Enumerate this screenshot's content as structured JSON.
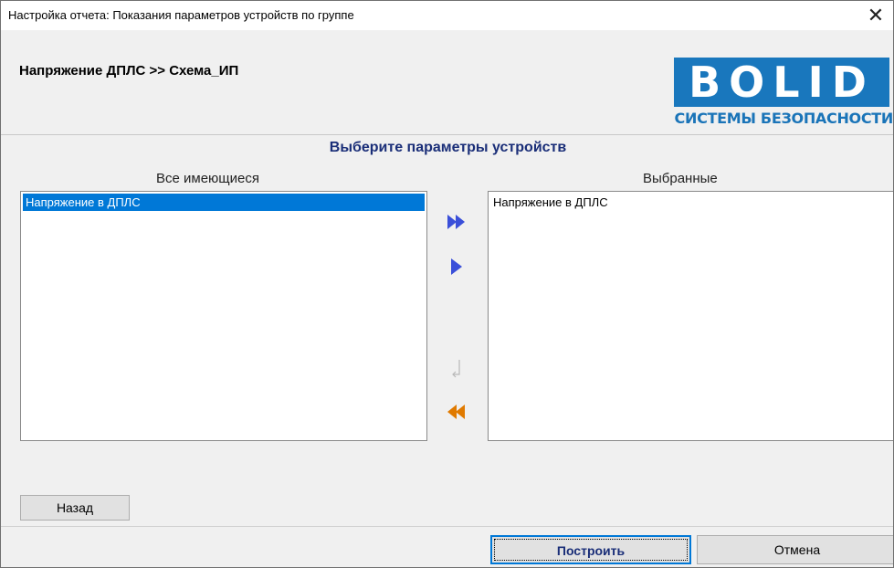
{
  "window": {
    "title": "Настройка отчета: Показания параметров устройств по группе"
  },
  "header": {
    "breadcrumb": "Напряжение ДПЛС >> Схема_ИП",
    "logo_text": "BOLID",
    "logo_subtitle": "СИСТЕМЫ БЕЗОПАСНОСТИ",
    "logo_color": "#1977bd"
  },
  "main": {
    "heading": "Выберите параметры устройств",
    "available_label": "Все имеющиеся",
    "selected_label": "Выбранные",
    "available_items": [
      "Напряжение в ДПЛС"
    ],
    "selected_items": [
      "Напряжение в ДПЛС"
    ]
  },
  "icons": {
    "add_all": "double-right-arrow-icon",
    "add_one": "right-arrow-icon",
    "remove_one": "left-arrow-icon-disabled",
    "remove_all": "double-left-arrow-icon"
  },
  "buttons": {
    "back": "Назад",
    "build": "Построить",
    "cancel": "Отмена"
  },
  "colors": {
    "selection": "#0078d7",
    "heading": "#1a2e78",
    "add_arrow": "#3a4fd9",
    "remove_arrow": "#e07a00"
  }
}
